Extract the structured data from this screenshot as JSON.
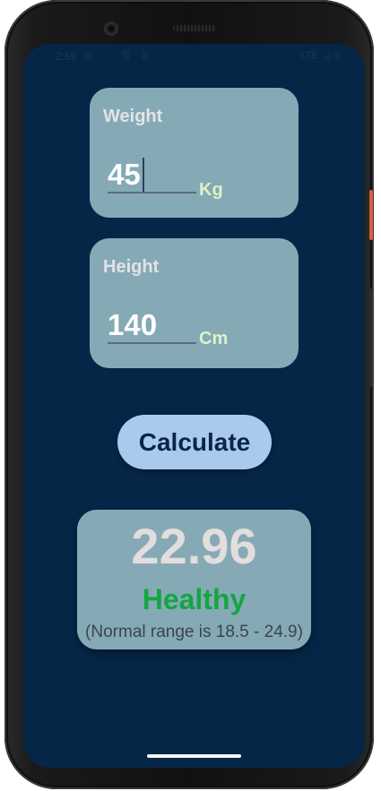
{
  "status_bar": {
    "time": "2:59",
    "network": "LTE",
    "icons": [
      "shield-icon",
      "accessibility-icon",
      "settings-icon",
      "sim-icon",
      "signal-icon",
      "battery-icon"
    ]
  },
  "weight_card": {
    "label": "Weight",
    "value": "45",
    "unit": "Kg"
  },
  "height_card": {
    "label": "Height",
    "value": "140",
    "unit": "Cm"
  },
  "calculate_button": {
    "label": "Calculate"
  },
  "result": {
    "bmi": "22.96",
    "status": "Healthy",
    "range_note": "(Normal range is 18.5 - 24.9)"
  },
  "colors": {
    "background": "#062648",
    "card": "#85aab6",
    "button": "#a9c9ee",
    "healthy": "#14a543",
    "unit": "#dcf2c7"
  }
}
